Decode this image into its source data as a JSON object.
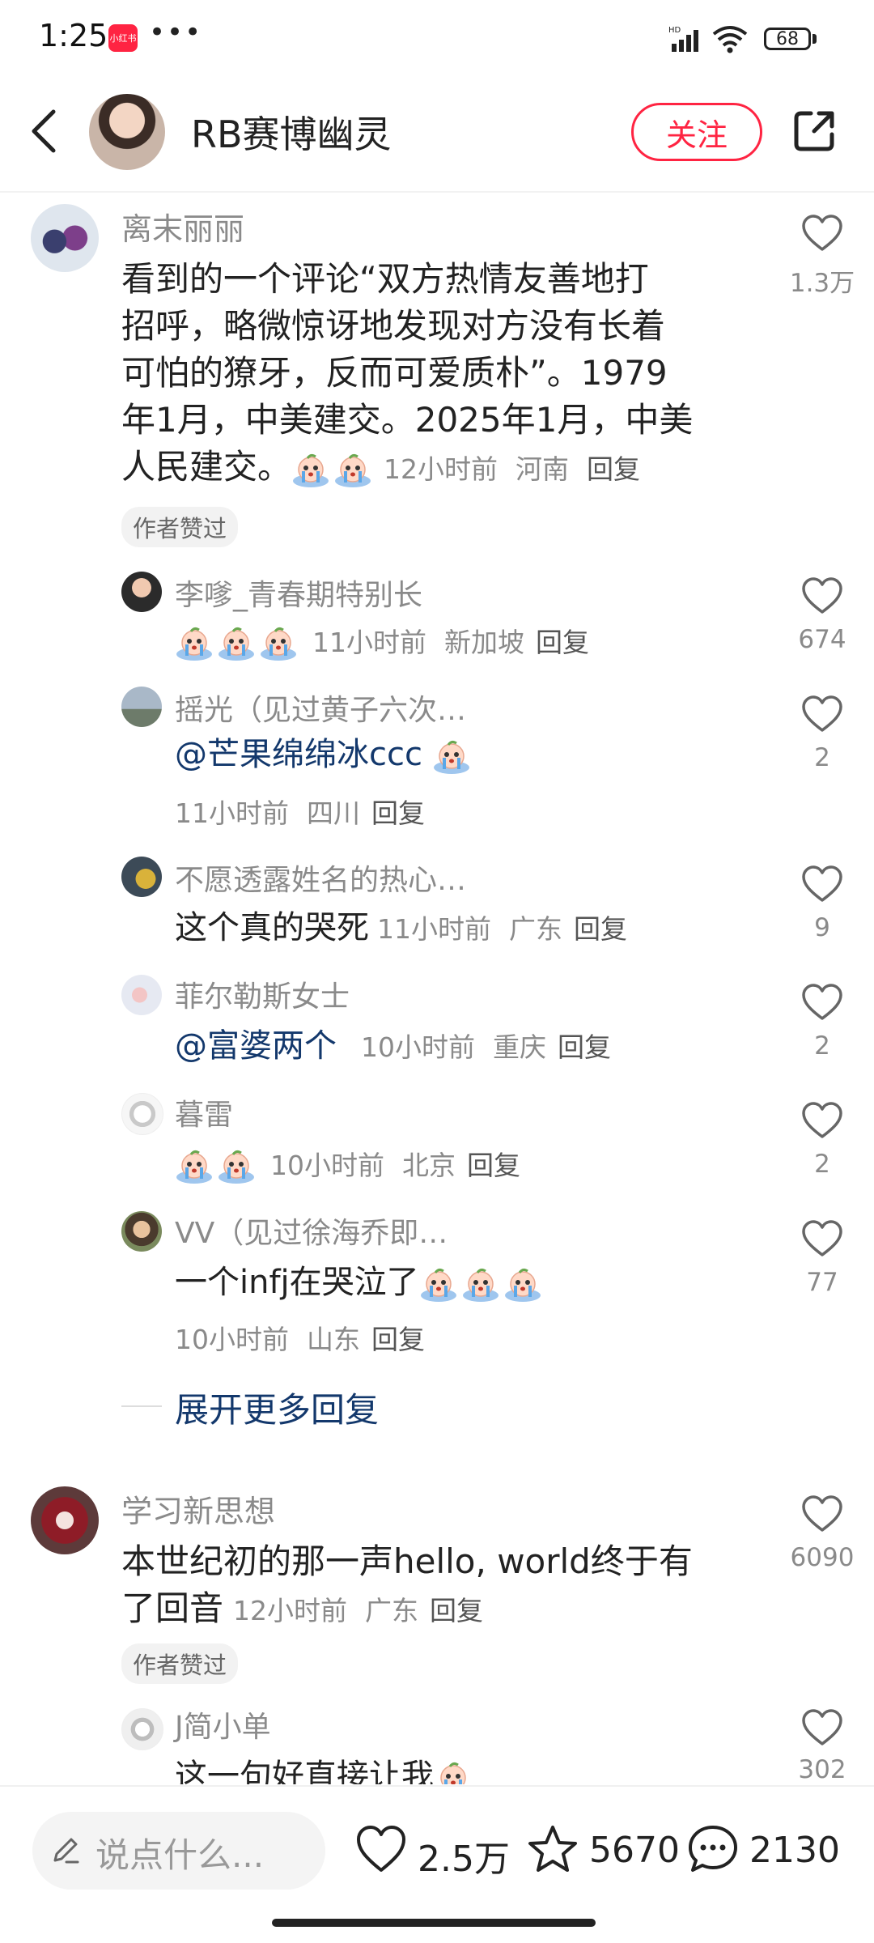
{
  "status_bar": {
    "time": "1:25",
    "app_badge": "小红书",
    "more": "•••",
    "battery": "68"
  },
  "header": {
    "username": "RB赛博幽灵",
    "follow_label": "关注"
  },
  "comments": [
    {
      "user": "离末丽丽",
      "text": "看到的一个评论“双方热情友善地打招呼，略微惊讶地发现对方没有长着可怕的獠牙，反而可爱质朴”。1979年1月，中美建交。2025年1月，中美人民建交。",
      "line1": "看到的一个评论“双方热情友善地打",
      "line2": "招呼，略微惊讶地发现对方没有长着",
      "line3": "可怕的獠牙，反而可爱质朴”。1979",
      "line4": "年1月，中美建交。2025年1月，中美",
      "line5": "人民建交。",
      "time": "12小时前",
      "location": "河南",
      "reply": "回复",
      "tag": "作者赞过",
      "likes": "1.3万",
      "replies": [
        {
          "user": "李嗲_青春期特别长",
          "text": "",
          "time": "11小时前",
          "location": "新加坡",
          "reply": "回复",
          "likes": "674"
        },
        {
          "user": "摇光（见过黄子六次…",
          "text": "@芒果绵绵冰ccc",
          "time": "11小时前",
          "location": "四川",
          "reply": "回复",
          "likes": "2"
        },
        {
          "user": "不愿透露姓名的热心…",
          "text": "这个真的哭死",
          "time": "11小时前",
          "location": "广东",
          "reply": "回复",
          "likes": "9"
        },
        {
          "user": "菲尔勒斯女士",
          "text": "@富婆两个",
          "time": "10小时前",
          "location": "重庆",
          "reply": "回复",
          "likes": "2"
        },
        {
          "user": "暮雷",
          "text": "",
          "time": "10小时前",
          "location": "北京",
          "reply": "回复",
          "likes": "2"
        },
        {
          "user": "VV（见过徐海乔即…",
          "text": "一个infj在哭泣了",
          "time": "10小时前",
          "location": "山东",
          "reply": "回复",
          "likes": "77"
        }
      ],
      "expand_label": "展开更多回复"
    },
    {
      "user": "学习新思想",
      "line1": "本世纪初的那一声hello, world终于有",
      "line2": "了回音",
      "time": "12小时前",
      "location": "广东",
      "reply": "回复",
      "tag": "作者赞过",
      "likes": "6090",
      "replies": [
        {
          "user": "J简小单",
          "text": "这一句好直接让我",
          "likes": "302"
        }
      ]
    }
  ],
  "bottom_bar": {
    "placeholder": "说点什么...",
    "likes": "2.5万",
    "favorites": "5670",
    "comments": "2130"
  },
  "colors": {
    "accent": "#ff2442",
    "mention": "#13386c",
    "meta": "#8a8a8a"
  }
}
